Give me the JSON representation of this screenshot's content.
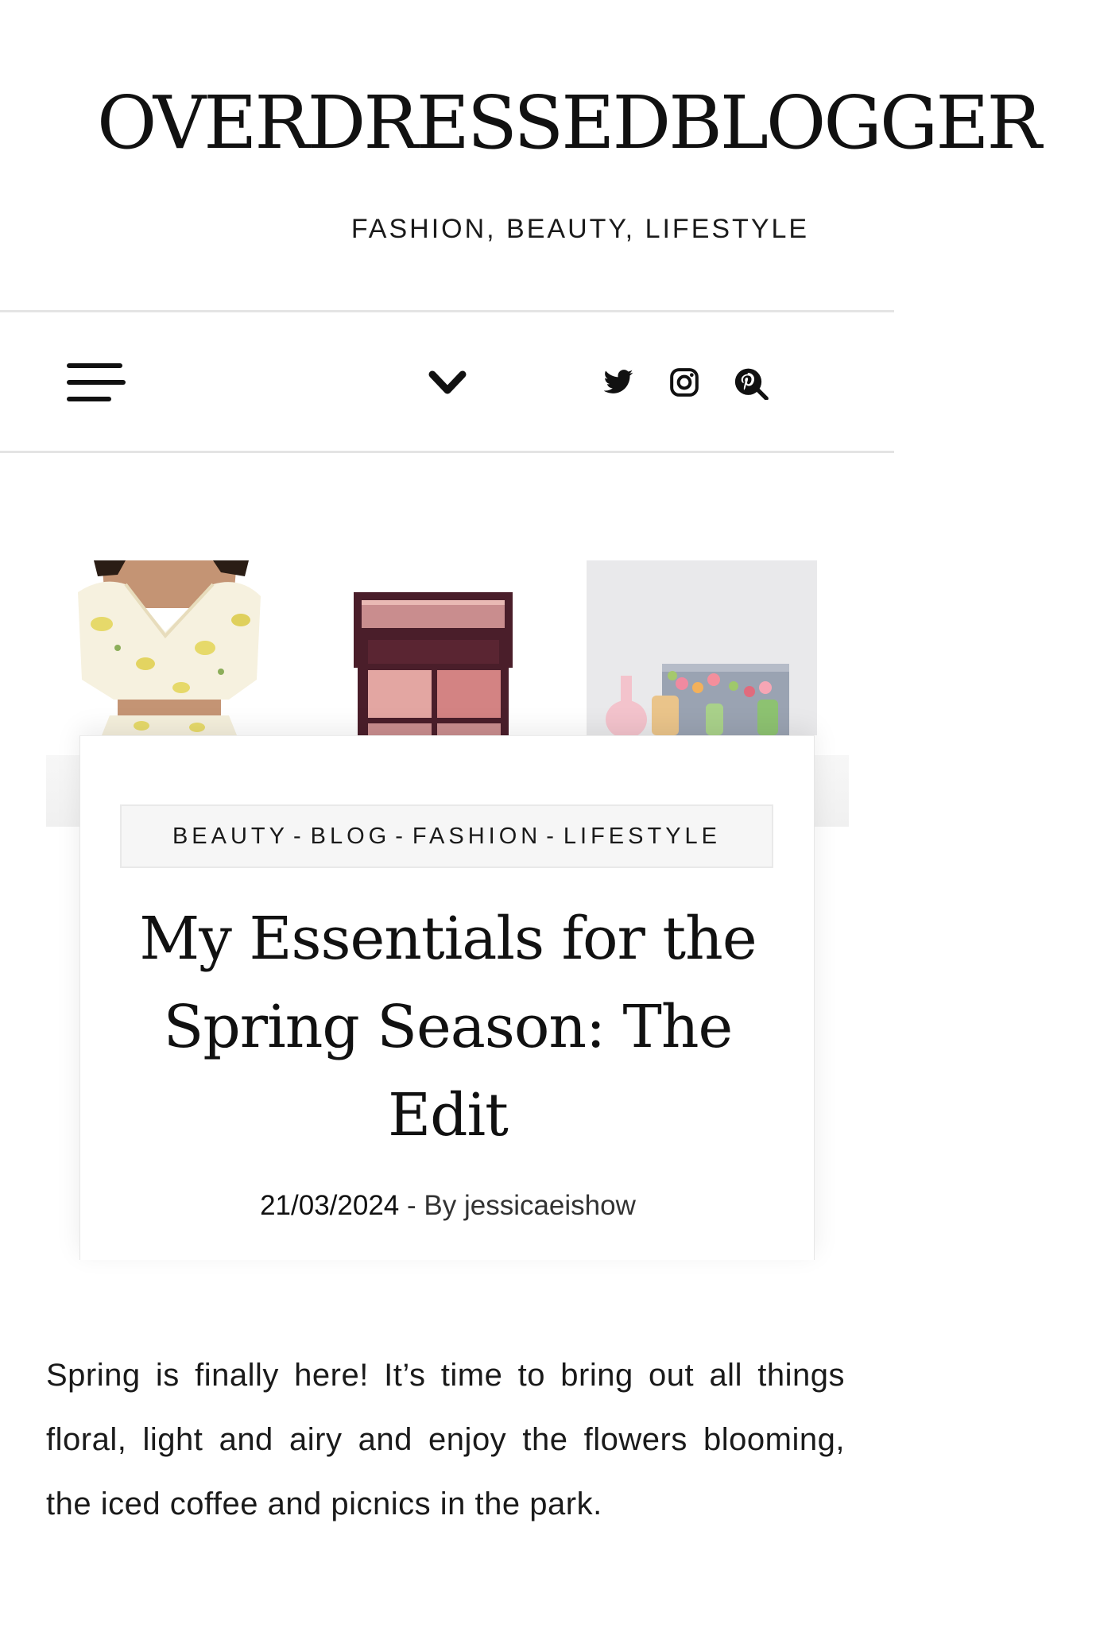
{
  "site": {
    "title": "OVERDRESSEDBLOGGER",
    "tagline": "FASHION, BEAUTY, LIFESTYLE"
  },
  "nav": {
    "menu_icon": "hamburger-menu-icon",
    "dropdown_icon": "chevron-down-icon",
    "social_icons": [
      "twitter-icon",
      "instagram-icon",
      "pinterest-icon"
    ]
  },
  "featured_images": [
    "fashion-photo",
    "eyeshadow-palette-photo",
    "vases-flowers-photo"
  ],
  "post": {
    "categories": [
      "BEAUTY",
      "BLOG",
      "FASHION",
      "LIFESTYLE"
    ],
    "category_separator": "-",
    "title": "My Essentials for the Spring Season: The Edit",
    "date": "21/03/2024",
    "meta_separator": " - By ",
    "author": "jessicaeishow",
    "excerpt": "Spring is finally here! It’s time to bring out all things floral, light and airy and enjoy the flowers blooming, the iced coffee and picnics in the park."
  },
  "colors": {
    "text": "#111111",
    "border": "#e4e4e4",
    "category_bg": "#f6f6f6"
  }
}
